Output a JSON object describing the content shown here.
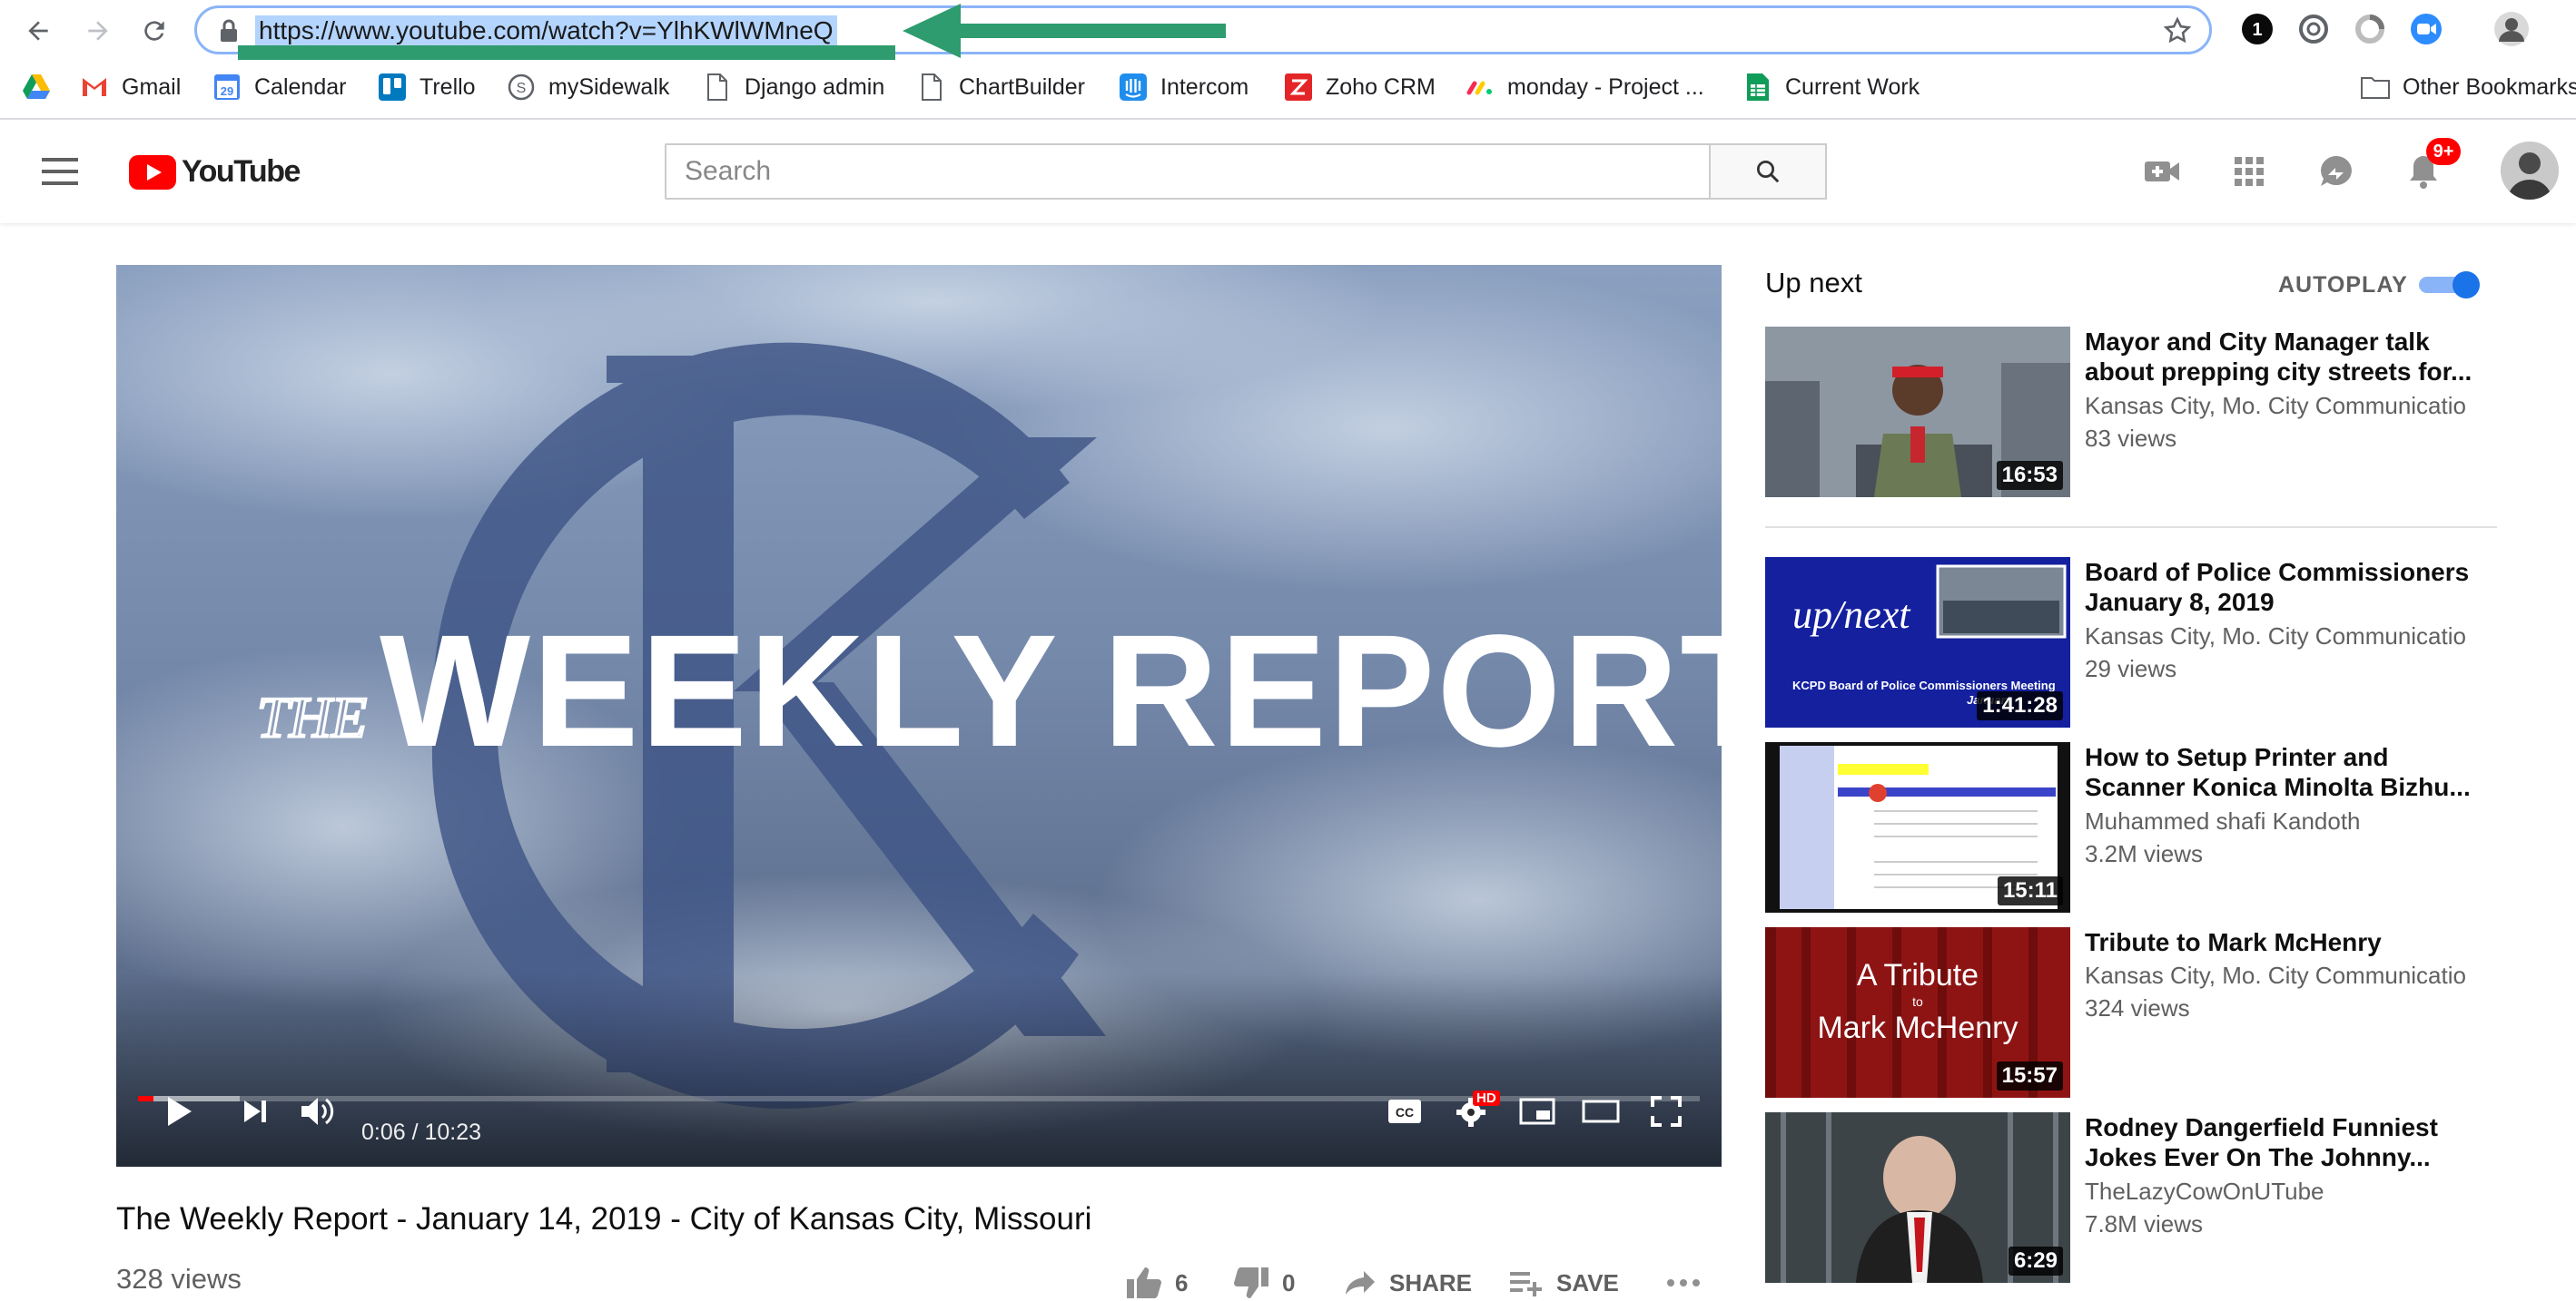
{
  "browser": {
    "url": "https://www.youtube.com/watch?v=YlhKWlWMneQ",
    "bookmarks": [
      {
        "label": "",
        "icon": "google-drive-icon"
      },
      {
        "label": "Gmail",
        "icon": "gmail-icon"
      },
      {
        "label": "Calendar",
        "icon": "calendar-icon"
      },
      {
        "label": "Trello",
        "icon": "trello-icon"
      },
      {
        "label": "mySidewalk",
        "icon": "mysidewalk-icon"
      },
      {
        "label": "Django admin",
        "icon": "page-icon"
      },
      {
        "label": "ChartBuilder",
        "icon": "page-icon"
      },
      {
        "label": "Intercom",
        "icon": "intercom-icon"
      },
      {
        "label": "Zoho CRM",
        "icon": "zoho-icon"
      },
      {
        "label": "monday - Project ...",
        "icon": "monday-icon"
      },
      {
        "label": "Current Work",
        "icon": "sheets-icon"
      }
    ],
    "other_bookmarks": "Other Bookmarks",
    "calendar_day": "29"
  },
  "masthead": {
    "logo_text": "YouTube",
    "search_placeholder": "Search",
    "notification_badge": "9+"
  },
  "video": {
    "overlay_the": "THE",
    "overlay_title": "WEEKLY REPORT",
    "time": "0:06 / 10:23",
    "played_fraction": 0.0098,
    "buffered_fraction": 0.065,
    "hd_badge": "HD",
    "title": "The Weekly Report - January 14, 2019 - City of Kansas City, Missouri",
    "views": "328 views",
    "likes": "6",
    "dislikes": "0",
    "share_label": "SHARE",
    "save_label": "SAVE"
  },
  "sidebar": {
    "up_next_label": "Up next",
    "autoplay_label": "AUTOPLAY",
    "autoplay_on": true,
    "items": [
      {
        "title": "Mayor and City Manager talk about prepping city streets for...",
        "channel": "Kansas City, Mo. City Communications",
        "views": "83 views",
        "duration": "16:53"
      },
      {
        "title": "Board of Police Commissioners January 8, 2019",
        "channel": "Kansas City, Mo. City Communications",
        "views": "29 views",
        "duration": "1:41:28",
        "thumb_text": "up/next",
        "thumb_caption": "KCPD Board of Police Commissioners Meeting",
        "thumb_sub": "January"
      },
      {
        "title": "How to Setup Printer and Scanner Konica Minolta Bizhu...",
        "channel": "Muhammed shafi Kandoth",
        "views": "3.2M views",
        "duration": "15:11"
      },
      {
        "title": "Tribute to Mark McHenry",
        "channel": "Kansas City, Mo. City Communications",
        "views": "324 views",
        "duration": "15:57",
        "thumb_line1": "A Tribute",
        "thumb_line2": "to",
        "thumb_line3": "Mark McHenry"
      },
      {
        "title": "Rodney Dangerfield Funniest Jokes Ever On The Johnny...",
        "channel": "TheLazyCowOnUTube",
        "views": "7.8M views",
        "duration": "6:29"
      }
    ]
  },
  "colors": {
    "youtube_red": "#ff0000",
    "toggle_blue": "#1a73e8",
    "annotation_green": "#2e9c6e",
    "url_highlight": "#b3d4fd"
  }
}
